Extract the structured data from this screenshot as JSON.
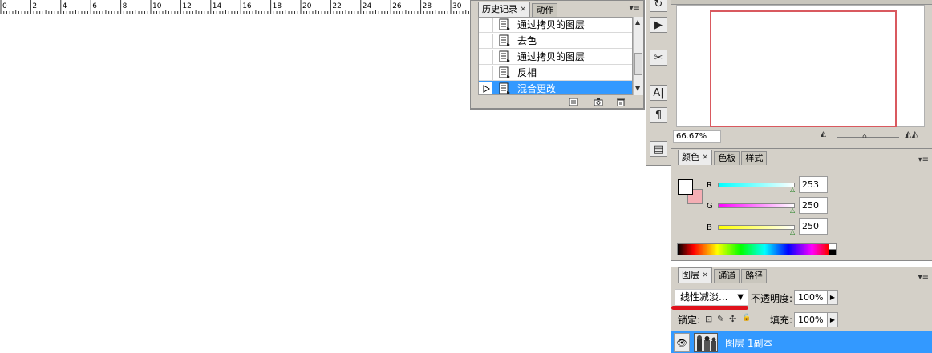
{
  "ruler": {
    "labels": [
      "0",
      "2",
      "4",
      "6",
      "8",
      "10",
      "12",
      "14",
      "16",
      "18",
      "20",
      "22",
      "24",
      "26",
      "28",
      "30"
    ]
  },
  "history": {
    "tabs": [
      {
        "label": "历史记录",
        "close": "×"
      },
      {
        "label": "动作"
      }
    ],
    "menu_icon": "▾≡",
    "steps": [
      {
        "label": "通过拷贝的图层"
      },
      {
        "label": "去色"
      },
      {
        "label": "通过拷贝的图层"
      },
      {
        "label": "反相"
      },
      {
        "label": "混合更改"
      }
    ],
    "scroll_up": "▲",
    "scroll_down": "▼"
  },
  "tools": {
    "icons": [
      "history-brush-icon",
      "play-icon",
      "tools-icon",
      "text-icon",
      "paragraph-icon",
      "document-icon"
    ],
    "glyphs": [
      "↻",
      "▶",
      "✂",
      "A|",
      "¶",
      "▤"
    ]
  },
  "navigator": {
    "zoom": "66.67%",
    "zoom_out_glyph": "◭",
    "zoom_in_glyph": "◭◭",
    "slider_glyph": "⌂",
    "view_box_color": "#d9595f"
  },
  "color": {
    "tabs": [
      {
        "label": "颜色",
        "close": "×"
      },
      {
        "label": "色板"
      },
      {
        "label": "样式"
      }
    ],
    "channels": [
      {
        "name": "R",
        "value": "253",
        "track_start": "#00ffff",
        "track_end": "#ffffff"
      },
      {
        "name": "G",
        "value": "250",
        "track_start": "#ff00ff",
        "track_end": "#ffffff"
      },
      {
        "name": "B",
        "value": "250",
        "track_start": "#ffff00",
        "track_end": "#ffffff"
      }
    ],
    "foreground": "#ffffff",
    "background": "#f4aeb4",
    "slider_thumb": "△"
  },
  "layers": {
    "tabs": [
      {
        "label": "图层",
        "close": "×"
      },
      {
        "label": "通道"
      },
      {
        "label": "路径"
      }
    ],
    "blend_mode": "线性减淡...",
    "blend_arrow": "▼",
    "opacity_label": "不透明度:",
    "opacity": "100%",
    "lock_label": "锁定:",
    "lock_glyphs": [
      "⊡",
      "✎",
      "✣",
      "🔒"
    ],
    "fill_label": "填充:",
    "fill": "100%",
    "step_arrow": "▶",
    "eye_glyph": "👁",
    "layer_name": "图层 1副本",
    "annotation_color": "#e0121b"
  }
}
